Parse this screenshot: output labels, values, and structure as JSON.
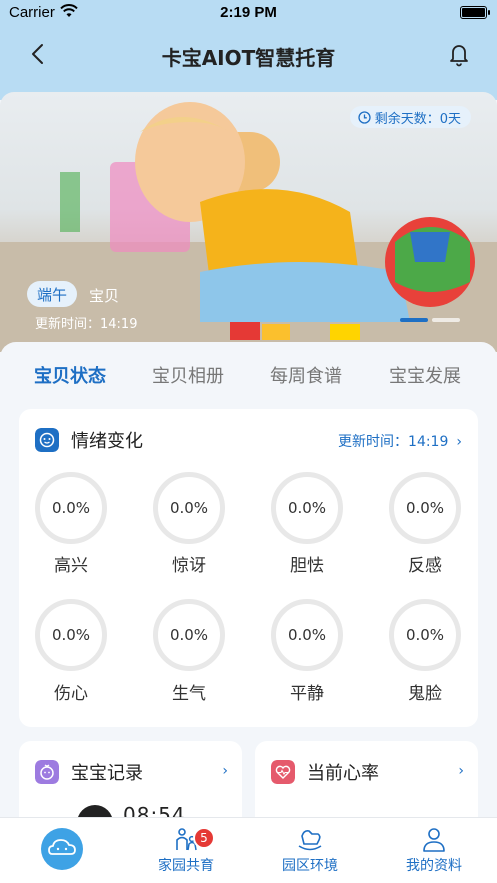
{
  "status_bar": {
    "carrier": "Carrier",
    "time": "2:19 PM"
  },
  "nav": {
    "title": "卡宝AIOT智慧托育"
  },
  "hero": {
    "days_label": "剩余天数：0天",
    "child_name": "端午",
    "child_role": "宝贝",
    "update_time": "更新时间：14:19"
  },
  "tabs": [
    {
      "label": "宝贝状态",
      "active": true
    },
    {
      "label": "宝贝相册",
      "active": false
    },
    {
      "label": "每周食谱",
      "active": false
    },
    {
      "label": "宝宝发展",
      "active": false
    }
  ],
  "emotion": {
    "title": "情绪变化",
    "update_link": "更新时间：14:19",
    "items": [
      {
        "value": "0.0%",
        "label": "高兴"
      },
      {
        "value": "0.0%",
        "label": "惊讶"
      },
      {
        "value": "0.0%",
        "label": "胆怯"
      },
      {
        "value": "0.0%",
        "label": "反感"
      },
      {
        "value": "0.0%",
        "label": "伤心"
      },
      {
        "value": "0.0%",
        "label": "生气"
      },
      {
        "value": "0.0%",
        "label": "平静"
      },
      {
        "value": "0.0%",
        "label": "鬼脸"
      }
    ]
  },
  "record": {
    "title": "宝宝记录",
    "time": "08:54"
  },
  "heart": {
    "title": "当前心率"
  },
  "tabbar": {
    "items": [
      {
        "label": ""
      },
      {
        "label": "家园共育",
        "badge": "5"
      },
      {
        "label": "园区环境"
      },
      {
        "label": "我的资料"
      }
    ]
  },
  "colors": {
    "accent": "#1e6fc4",
    "header": "#b8dcf3",
    "badge": "#e53935"
  }
}
